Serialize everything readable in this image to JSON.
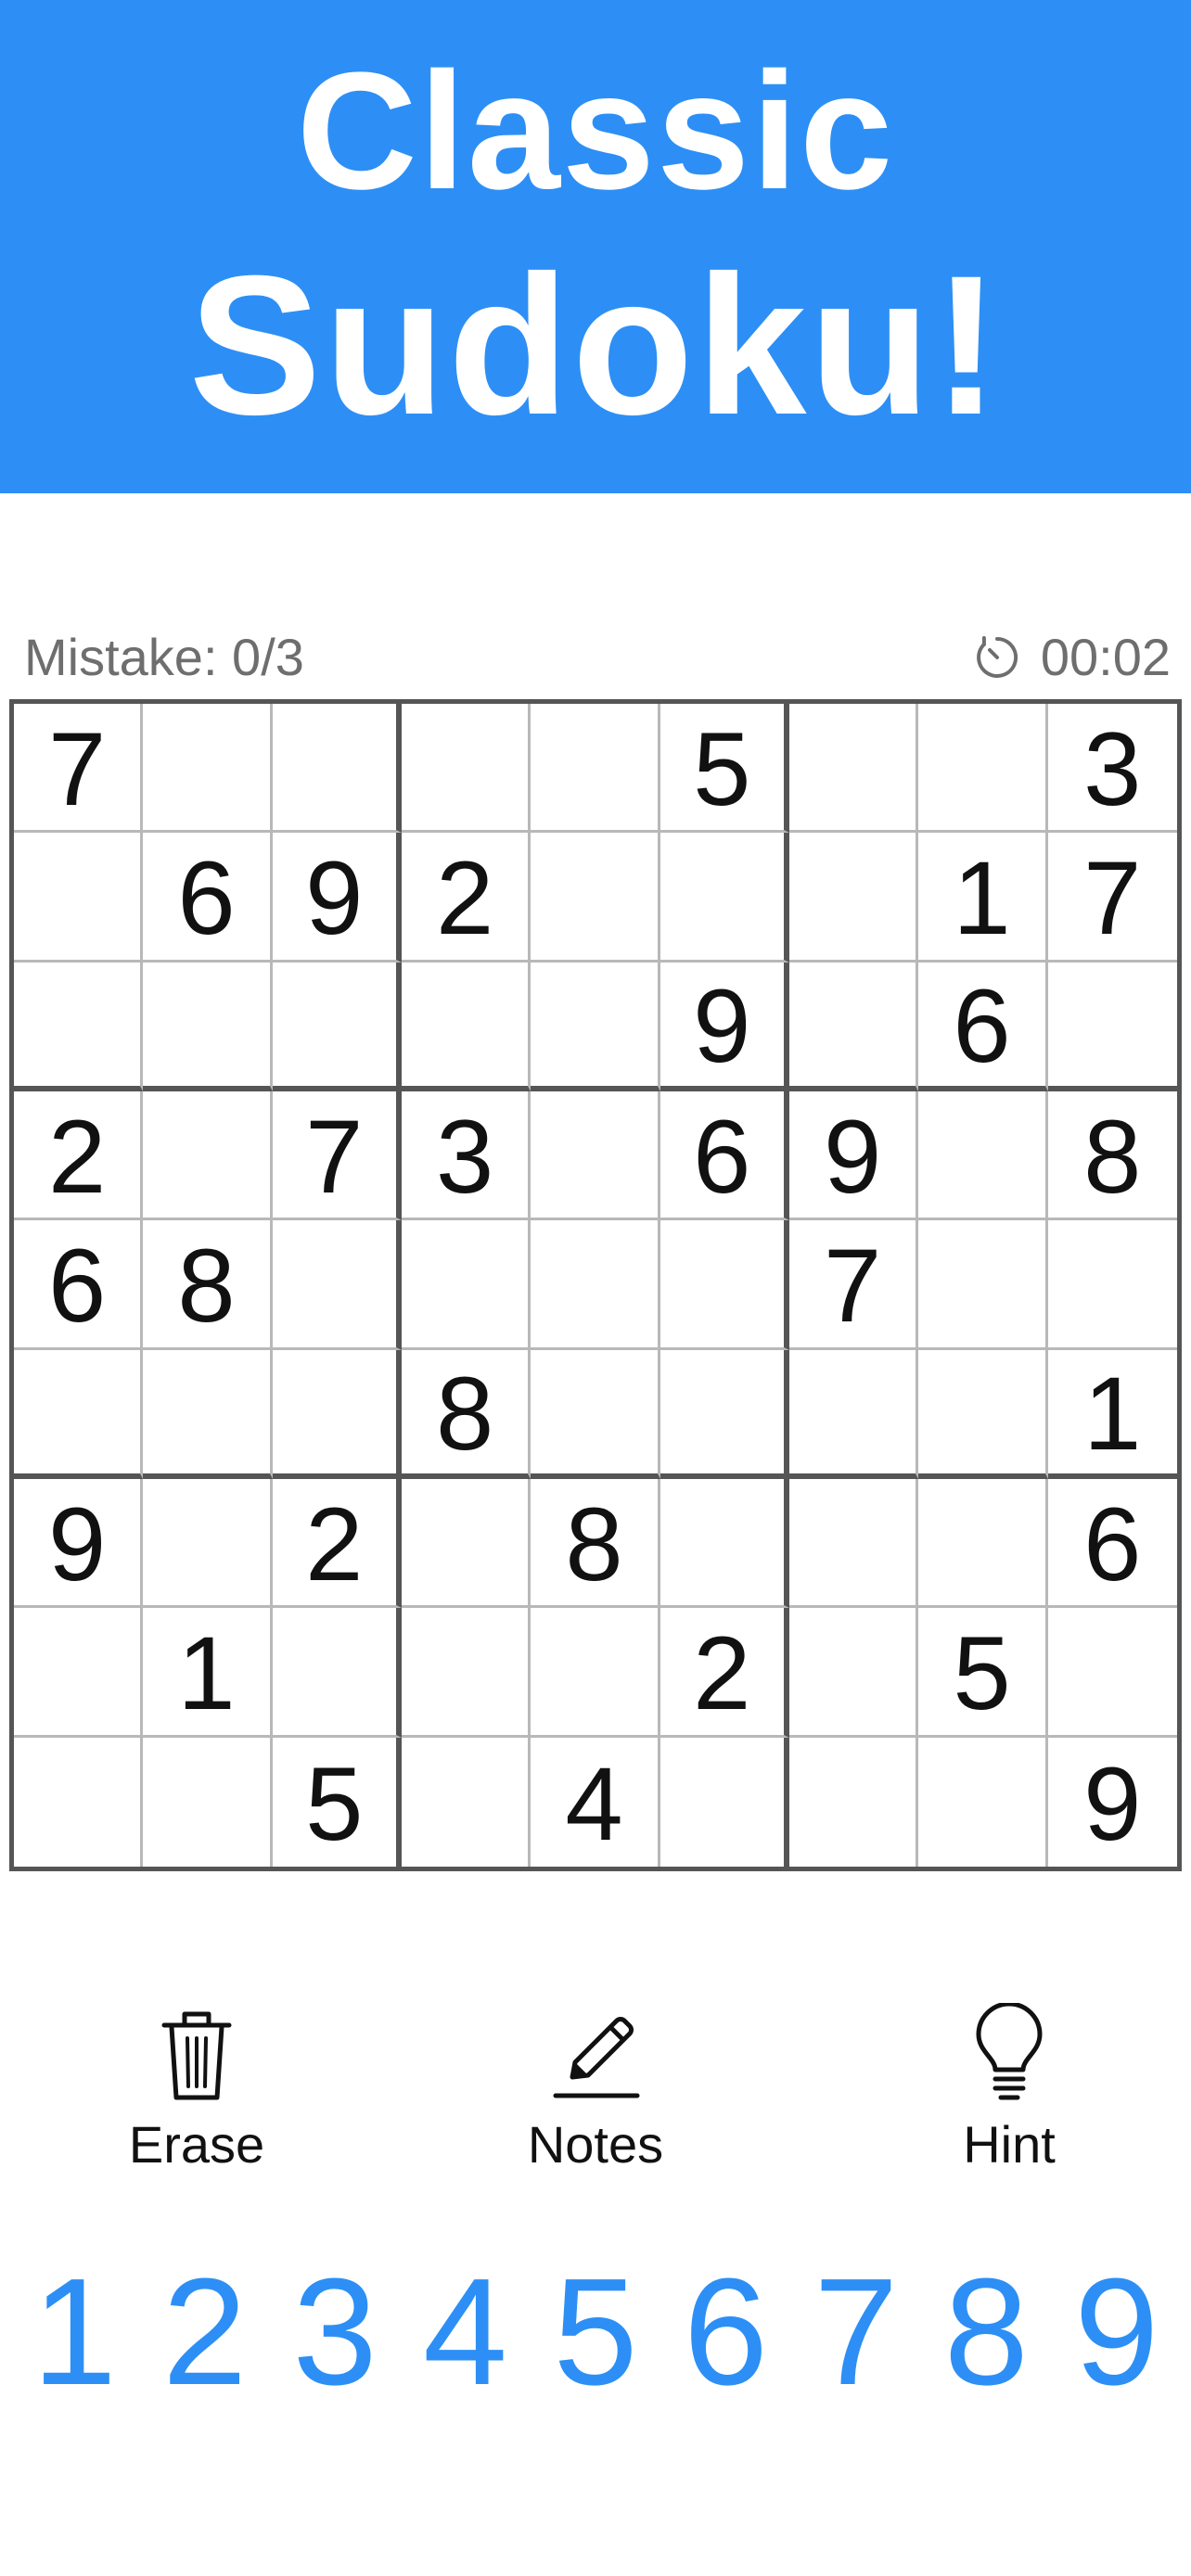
{
  "header": {
    "title_line1": "Classic",
    "title_line2": "Sudoku!"
  },
  "status": {
    "mistakes_text": "Mistake: 0/3",
    "timer_text": "00:02",
    "timer_icon": "stopwatch-icon"
  },
  "board": {
    "rows": [
      [
        "7",
        "",
        "",
        "",
        "",
        "5",
        "",
        "",
        "3"
      ],
      [
        "",
        "6",
        "9",
        "2",
        "",
        "",
        "",
        "1",
        "7"
      ],
      [
        "",
        "",
        "",
        "",
        "",
        "9",
        "",
        "6",
        ""
      ],
      [
        "2",
        "",
        "7",
        "3",
        "",
        "6",
        "9",
        "",
        "8"
      ],
      [
        "6",
        "8",
        "",
        "",
        "",
        "",
        "7",
        "",
        ""
      ],
      [
        "",
        "",
        "",
        "8",
        "",
        "",
        "",
        "",
        "1"
      ],
      [
        "9",
        "",
        "2",
        "",
        "8",
        "",
        "",
        "",
        "6"
      ],
      [
        "",
        "1",
        "",
        "",
        "",
        "2",
        "",
        "5",
        ""
      ],
      [
        "",
        "",
        "5",
        "",
        "4",
        "",
        "",
        "",
        "9"
      ]
    ]
  },
  "tools": {
    "erase": {
      "label": "Erase",
      "icon": "trash-icon"
    },
    "notes": {
      "label": "Notes",
      "icon": "pencil-icon"
    },
    "hint": {
      "label": "Hint",
      "icon": "lightbulb-icon"
    }
  },
  "numpad": {
    "keys": [
      "1",
      "2",
      "3",
      "4",
      "5",
      "6",
      "7",
      "8",
      "9"
    ]
  },
  "colors": {
    "accent": "#2d8ff5",
    "banner_text": "#ffffff",
    "status_text": "#6e6e6e",
    "grid_thick": "#555555",
    "grid_thin": "#b8b8b8",
    "digit": "#111111"
  }
}
